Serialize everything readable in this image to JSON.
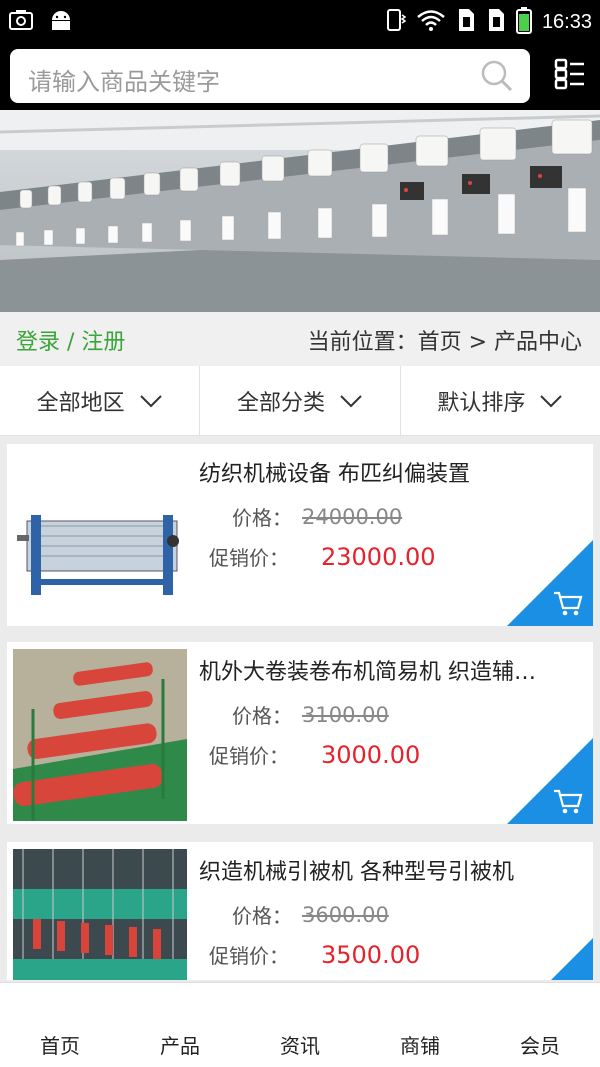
{
  "status_bar": {
    "time": "16:33",
    "icons": [
      "screenshot-icon",
      "android-icon",
      "vibrate-icon",
      "wifi-icon",
      "sim1-icon",
      "sim2-icon",
      "battery-icon"
    ]
  },
  "search": {
    "placeholder": "请输入商品关键字"
  },
  "location": {
    "login_label": "登录 / 注册",
    "breadcrumb": "当前位置：首页 > 产品中心"
  },
  "filters": [
    {
      "label": "全部地区"
    },
    {
      "label": "全部分类"
    },
    {
      "label": "默认排序"
    }
  ],
  "products": [
    {
      "title": "纺织机械设备 布匹纠偏装置",
      "price_label": "价格：",
      "price": "24000.00",
      "promo_label": "促销价：",
      "promo_price": "23000.00"
    },
    {
      "title": "机外大卷装卷布机简易机 织造辅…",
      "price_label": "价格：",
      "price": "3100.00",
      "promo_label": "促销价：",
      "promo_price": "3000.00"
    },
    {
      "title": "织造机械引被机 各种型号引被机",
      "price_label": "价格：",
      "price": "3600.00",
      "promo_label": "促销价：",
      "promo_price": "3500.00"
    }
  ],
  "bottom_nav": [
    {
      "label": "首页"
    },
    {
      "label": "产品"
    },
    {
      "label": "资讯"
    },
    {
      "label": "商铺"
    },
    {
      "label": "会员"
    }
  ],
  "colors": {
    "accent_blue": "#1a8fe3",
    "promo_red": "#e8212b",
    "login_green": "#3aa53a"
  }
}
